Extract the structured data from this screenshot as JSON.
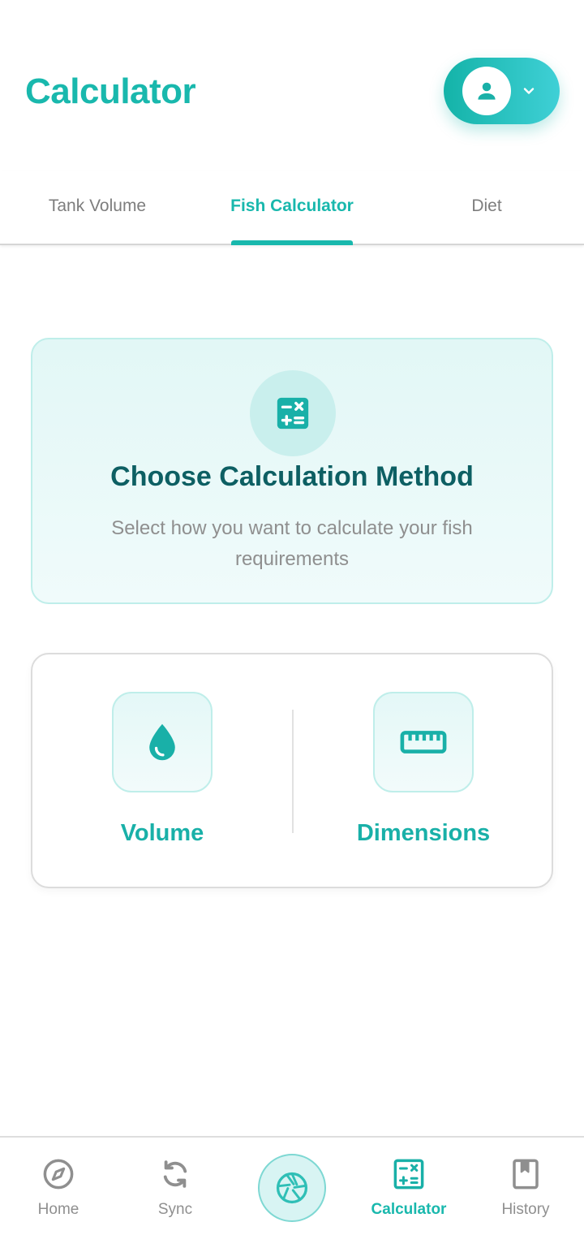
{
  "header": {
    "title": "Calculator",
    "profile_icon": "person-icon",
    "dropdown_icon": "chevron-down-icon"
  },
  "tabs": [
    {
      "label": "Tank Volume",
      "active": false
    },
    {
      "label": "Fish Calculator",
      "active": true
    },
    {
      "label": "Diet",
      "active": false
    }
  ],
  "info_card": {
    "icon": "calculator-icon",
    "title": "Choose Calculation Method",
    "subtitle": "Select how you want to calculate your fish requirements"
  },
  "methods": [
    {
      "label": "Volume",
      "icon": "water-drop-icon"
    },
    {
      "label": "Dimensions",
      "icon": "ruler-icon"
    }
  ],
  "bottom_nav": [
    {
      "label": "Home",
      "icon": "compass-icon",
      "active": false
    },
    {
      "label": "Sync",
      "icon": "sync-icon",
      "active": false
    },
    {
      "label": "",
      "icon": "camera-aperture-icon",
      "active": false
    },
    {
      "label": "Calculator",
      "icon": "calculator-icon",
      "active": true
    },
    {
      "label": "History",
      "icon": "bookmark-book-icon",
      "active": false
    }
  ],
  "colors": {
    "accent": "#19b8ad",
    "title_dark": "#0d5f63",
    "muted_text": "#8f8f8f"
  }
}
